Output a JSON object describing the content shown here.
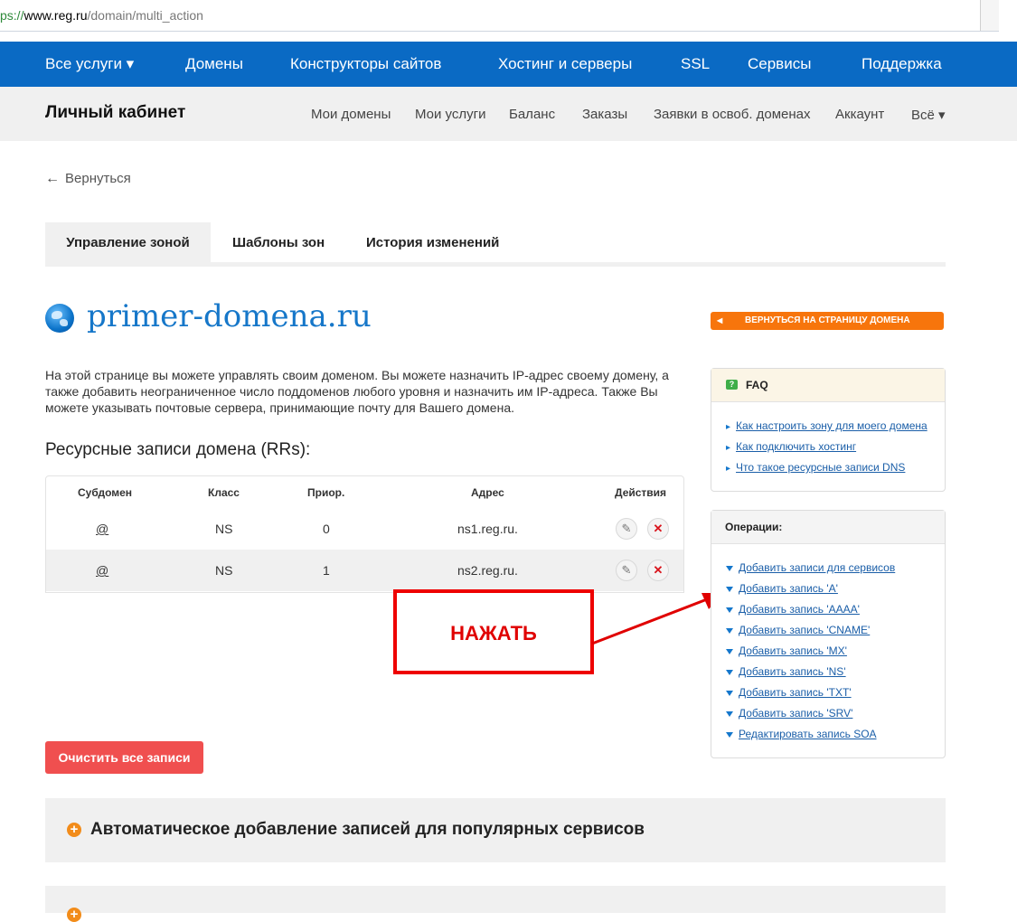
{
  "browser": {
    "url_scheme": "ps://",
    "url_host": "www.reg.ru",
    "url_path": "/domain/multi_action"
  },
  "topnav": {
    "items": [
      "Все услуги ▾",
      "Домены",
      "Конструкторы сайтов",
      "Хостинг и серверы",
      "SSL",
      "Сервисы",
      "Поддержка"
    ]
  },
  "subnav": {
    "brand": "Личный кабинет",
    "items": [
      "Мои домены",
      "Мои услуги",
      "Баланс",
      "Заказы",
      "Заявки в освоб. доменах",
      "Аккаунт",
      "Всё ▾"
    ]
  },
  "back_label": "Вернуться",
  "tabs": [
    "Управление зоной",
    "Шаблоны зон",
    "История изменений"
  ],
  "domain_name": "primer-domena.ru",
  "return_button": "ВЕРНУТЬСЯ НА СТРАНИЦУ ДОМЕНА",
  "intro_text": "На этой странице вы можете управлять своим доменом. Вы можете назначить IP-адрес своему домену, а также добавить неограниченное число поддоменов любого уровня и назначить им IP-адреса. Также Вы можете указывать почтовые сервера, принимающие почту для Вашего домена.",
  "records_title": "Ресурсные записи домена (RRs):",
  "table": {
    "headers": [
      "Субдомен",
      "Класс",
      "Приор.",
      "Адрес",
      "Действия"
    ],
    "rows": [
      {
        "subdomain": "@",
        "class": "NS",
        "priority": "0",
        "address": "ns1.reg.ru."
      },
      {
        "subdomain": "@",
        "class": "NS",
        "priority": "1",
        "address": "ns2.reg.ru."
      }
    ]
  },
  "callout": "НАЖАТЬ",
  "faq": {
    "title": "FAQ",
    "links": [
      "Как настроить зону для моего домена",
      "Как подключить хостинг",
      "Что такое ресурсные записи DNS"
    ]
  },
  "operations": {
    "title": "Операции:",
    "links": [
      "Добавить записи для сервисов",
      "Добавить запись 'A'",
      "Добавить запись 'AAAA'",
      "Добавить запись 'CNAME'",
      "Добавить запись 'MX'",
      "Добавить запись 'NS'",
      "Добавить запись 'TXT'",
      "Добавить запись 'SRV'",
      "Редактировать запись SOA"
    ]
  },
  "clear_button": "Очистить все записи",
  "accordion": {
    "auto_title": "Автоматическое добавление записей для популярных сервисов"
  },
  "colors": {
    "nav_blue": "#0a6ac4",
    "accent_orange": "#f7750c",
    "danger_red": "#f04f4f",
    "callout_red": "#e00000",
    "link_blue": "#1a5ea8"
  }
}
